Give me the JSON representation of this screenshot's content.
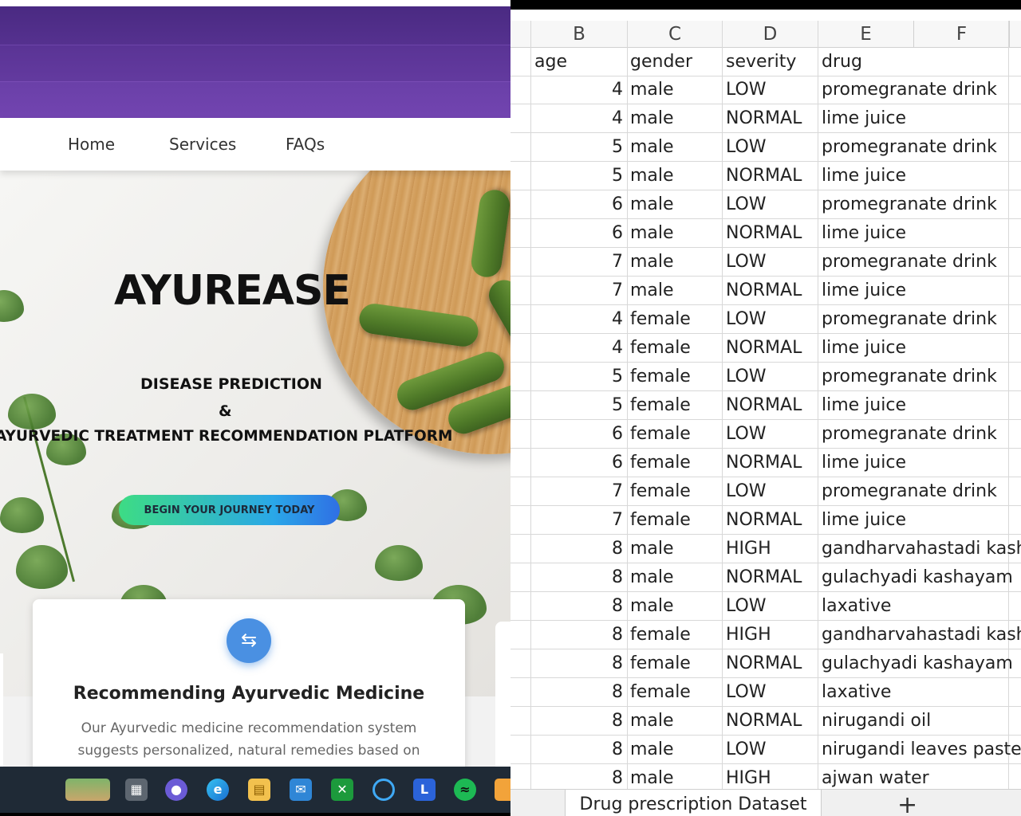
{
  "website": {
    "nav": [
      "Home",
      "Services",
      "FAQs"
    ],
    "brand": "AYUREASE",
    "tagline_1": "DISEASE PREDICTION",
    "tagline_2": "&",
    "tagline_3": "AYURVEDIC TREATMENT RECOMMENDATION PLATFORM",
    "cta": "BEGIN YOUR JOURNEY TODAY",
    "card": {
      "icon": "repeat-icon",
      "title": "Recommending Ayurvedic Medicine",
      "text": "Our Ayurvedic medicine recommendation system suggests personalized, natural remedies based on individual"
    },
    "taskbar_icons": [
      "landscape-thumbnail-icon",
      "task-view-icon",
      "teams-chat-icon",
      "edge-icon",
      "file-explorer-icon",
      "mail-icon",
      "xbox-icon",
      "cortana-icon",
      "l-app-icon",
      "spotify-icon"
    ]
  },
  "sheet": {
    "columns": [
      "B",
      "C",
      "D",
      "E",
      "F"
    ],
    "headers": {
      "age": "age",
      "gender": "gender",
      "severity": "severity",
      "drug": "drug"
    },
    "rows": [
      [
        "4",
        "male",
        "LOW",
        "promegranate drink"
      ],
      [
        "4",
        "male",
        "NORMAL",
        "lime juice"
      ],
      [
        "5",
        "male",
        "LOW",
        "promegranate drink"
      ],
      [
        "5",
        "male",
        "NORMAL",
        "lime juice"
      ],
      [
        "6",
        "male",
        "LOW",
        "promegranate drink"
      ],
      [
        "6",
        "male",
        "NORMAL",
        "lime juice"
      ],
      [
        "7",
        "male",
        "LOW",
        "promegranate drink"
      ],
      [
        "7",
        "male",
        "NORMAL",
        "lime juice"
      ],
      [
        "4",
        "female",
        "LOW",
        "promegranate drink"
      ],
      [
        "4",
        "female",
        "NORMAL",
        "lime juice"
      ],
      [
        "5",
        "female",
        "LOW",
        "promegranate drink"
      ],
      [
        "5",
        "female",
        "NORMAL",
        "lime juice"
      ],
      [
        "6",
        "female",
        "LOW",
        "promegranate drink"
      ],
      [
        "6",
        "female",
        "NORMAL",
        "lime juice"
      ],
      [
        "7",
        "female",
        "LOW",
        "promegranate drink"
      ],
      [
        "7",
        "female",
        "NORMAL",
        "lime juice"
      ],
      [
        "8",
        "male",
        "HIGH",
        "gandharvahastadi kasha"
      ],
      [
        "8",
        "male",
        "NORMAL",
        "gulachyadi kashayam"
      ],
      [
        "8",
        "male",
        "LOW",
        "laxative"
      ],
      [
        "8",
        "female",
        "HIGH",
        "gandharvahastadi kasha"
      ],
      [
        "8",
        "female",
        "NORMAL",
        "gulachyadi kashayam"
      ],
      [
        "8",
        "female",
        "LOW",
        "laxative"
      ],
      [
        "8",
        "male",
        "NORMAL",
        "nirugandi oil"
      ],
      [
        "8",
        "male",
        "LOW",
        "nirugandi leaves paste"
      ],
      [
        "8",
        "male",
        "HIGH",
        "ajwan water"
      ]
    ],
    "tab_name": "Drug prescription Dataset",
    "add_sheet": "+"
  },
  "colors": {
    "purple": "#55318f",
    "cta_start": "#3ddc84",
    "cta_end": "#2f6fe4",
    "card_icon": "#4a90e2"
  }
}
